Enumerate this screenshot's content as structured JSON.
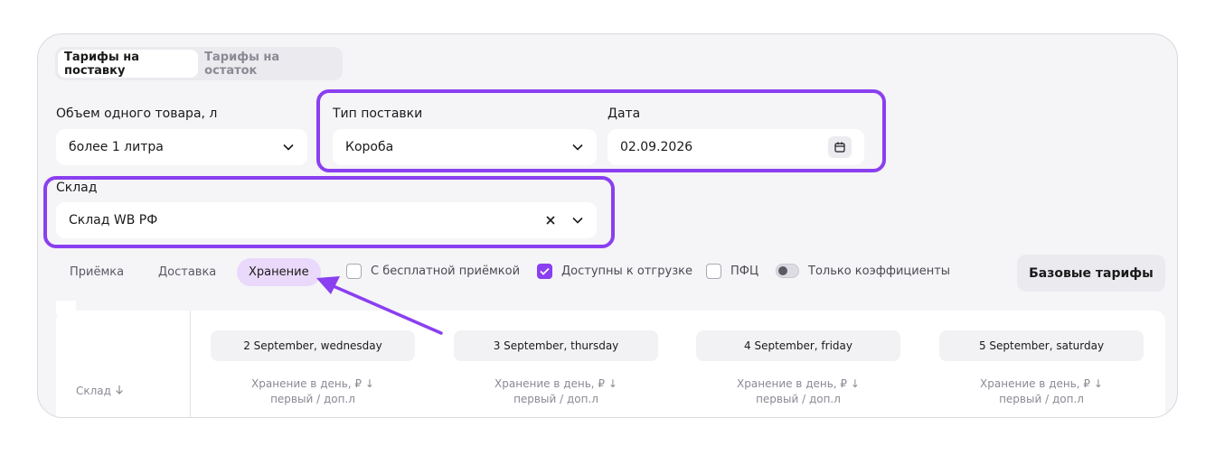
{
  "tabs": [
    {
      "label": "Тарифы на поставку",
      "active": true
    },
    {
      "label": "Тарифы на остаток",
      "active": false
    }
  ],
  "volume": {
    "label": "Объем одного товара, л",
    "value": "более 1 литра"
  },
  "supply_type": {
    "label": "Тип поставки",
    "value": "Короба"
  },
  "date": {
    "label": "Дата",
    "value": "02.09.2026"
  },
  "warehouse": {
    "label": "Склад",
    "value": "Склад WB РФ"
  },
  "segments": [
    "Приёмка",
    "Доставка",
    "Хранение"
  ],
  "active_segment": "Хранение",
  "checkboxes": [
    {
      "label": "С бесплатной приёмкой",
      "checked": false
    },
    {
      "label": "Доступны к отгрузке",
      "checked": true
    },
    {
      "label": "ПФЦ",
      "checked": false
    }
  ],
  "toggle": {
    "label": "Только коэффициенты",
    "on": false
  },
  "base_button": "Базовые тарифы",
  "table": {
    "first_col": "Склад",
    "days": [
      {
        "title": "2 September, wednesday",
        "sub1": "Хранение в день, ₽",
        "sub2": "первый / доп.л"
      },
      {
        "title": "3 September, thursday",
        "sub1": "Хранение в день, ₽",
        "sub2": "первый / доп.л"
      },
      {
        "title": "4 September, friday",
        "sub1": "Хранение в день, ₽",
        "sub2": "первый / доп.л"
      },
      {
        "title": "5 September, saturday",
        "sub1": "Хранение в день, ₽",
        "sub2": "первый / доп.л"
      }
    ]
  },
  "colors": {
    "accent": "#8a3ff0",
    "segment_active_bg": "#ead9fb",
    "panel_bg": "#f5f4f7"
  }
}
